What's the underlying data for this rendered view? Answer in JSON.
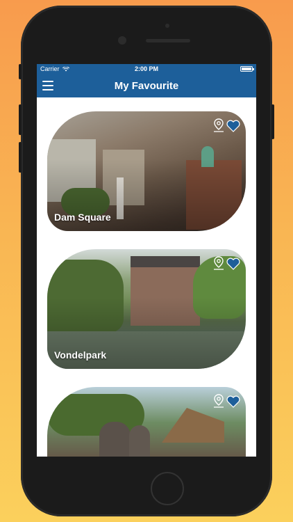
{
  "status_bar": {
    "carrier": "Carrier",
    "time": "2:00 PM"
  },
  "nav": {
    "title": "My Favourite",
    "menu_icon": "hamburger-icon"
  },
  "places": [
    {
      "name": "Dam Square",
      "location_icon": "map-pin-icon",
      "favourite_icon": "heart-icon"
    },
    {
      "name": "Vondelpark",
      "location_icon": "map-pin-icon",
      "favourite_icon": "heart-icon"
    },
    {
      "name": "",
      "location_icon": "map-pin-icon",
      "favourite_icon": "heart-icon"
    }
  ],
  "colors": {
    "accent": "#1d5f9a",
    "background_top": "#f89b4d",
    "background_bottom": "#fbd05c",
    "heart": "#1d5f9a"
  }
}
